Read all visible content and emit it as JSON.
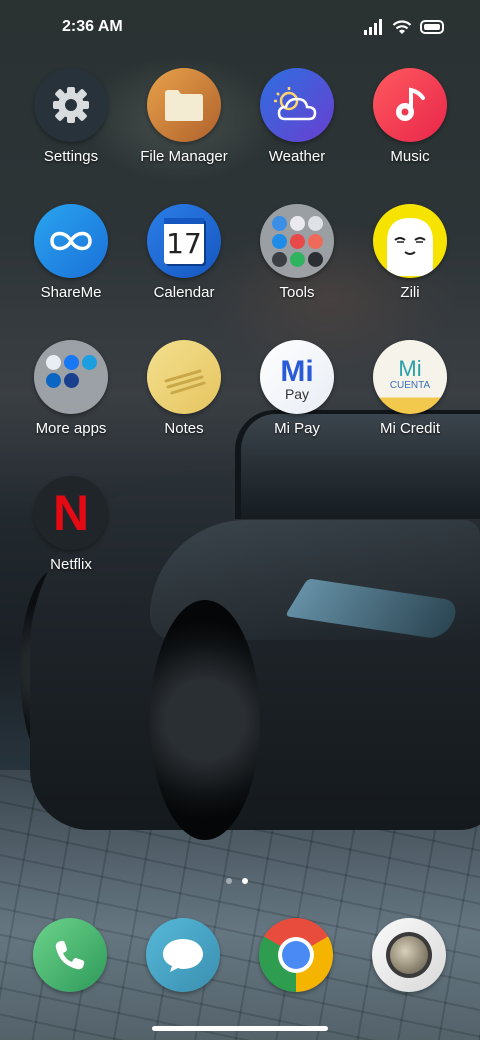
{
  "status_bar": {
    "time": "2:36 AM"
  },
  "apps": [
    {
      "id": "settings",
      "label": "Settings"
    },
    {
      "id": "file-manager",
      "label": "File Manager"
    },
    {
      "id": "weather",
      "label": "Weather"
    },
    {
      "id": "music",
      "label": "Music"
    },
    {
      "id": "shareme",
      "label": "ShareMe"
    },
    {
      "id": "calendar",
      "label": "Calendar",
      "date_number": "17"
    },
    {
      "id": "tools",
      "label": "Tools"
    },
    {
      "id": "zili",
      "label": "Zili"
    },
    {
      "id": "more-apps",
      "label": "More apps"
    },
    {
      "id": "notes",
      "label": "Notes"
    },
    {
      "id": "mi-pay",
      "label": "Mi Pay",
      "icon_text_top": "Mi",
      "icon_text_bottom": "Pay"
    },
    {
      "id": "mi-credit",
      "label": "Mi Credit",
      "icon_text_top": "Mi",
      "icon_text_bottom": "CUENTA"
    },
    {
      "id": "netflix",
      "label": "Netflix",
      "icon_text": "N"
    }
  ],
  "page_indicator": {
    "count": 2,
    "active": 2
  },
  "dock": [
    {
      "id": "phone",
      "icon": "phone-icon"
    },
    {
      "id": "messages",
      "icon": "message-bubble-icon"
    },
    {
      "id": "chrome",
      "icon": "chrome-icon"
    },
    {
      "id": "camera",
      "icon": "camera-lens-icon"
    }
  ],
  "colors": {
    "accent_red": "#e8413f",
    "netflix_red": "#e50914",
    "shareme_blue": "#1d8fe0",
    "calendar_blue": "#1f6fd6",
    "zili_yellow": "#f6e400"
  }
}
